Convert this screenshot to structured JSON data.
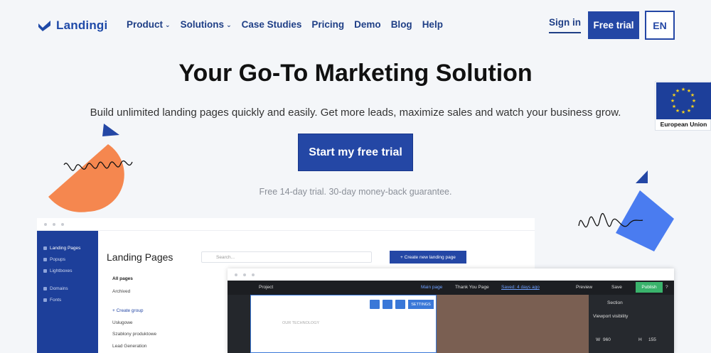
{
  "nav": {
    "logo_text": "Landingi",
    "menu": [
      {
        "label": "Product",
        "has_dropdown": true
      },
      {
        "label": "Solutions",
        "has_dropdown": true
      },
      {
        "label": "Case Studies",
        "has_dropdown": false
      },
      {
        "label": "Pricing",
        "has_dropdown": false
      },
      {
        "label": "Demo",
        "has_dropdown": false
      },
      {
        "label": "Blog",
        "has_dropdown": false
      },
      {
        "label": "Help",
        "has_dropdown": false
      }
    ],
    "chevron": "⌄",
    "sign_in": "Sign in",
    "free_trial": "Free trial",
    "language": "EN"
  },
  "hero": {
    "title": "Your Go-To Marketing Solution",
    "subtitle": "Build unlimited landing pages quickly and easily. Get more leads, maximize sales and watch your business grow.",
    "cta": "Start my free trial",
    "note": "Free 14-day trial. 30-day money-back guarantee."
  },
  "eu_badge": {
    "label": "European Union"
  },
  "app": {
    "sidebar": [
      "Landing Pages",
      "Popups",
      "Lightboxes",
      "Domains",
      "Fonts"
    ],
    "page_title": "Landing Pages",
    "search_placeholder": "Search...",
    "new_button": "+ Create new landing page",
    "filters": [
      "All pages",
      "Archived"
    ],
    "create_group": "+ Create group",
    "groups": [
      "Usługowe",
      "Szablony produktowe",
      "Lead Generation"
    ]
  },
  "editor": {
    "project": "Project",
    "main_page": "Main page",
    "thank_you": "Thank You Page",
    "saved": "Saved: 4 days ago",
    "preview": "Preview",
    "save": "Save",
    "publish": "Publish",
    "help": "?",
    "settings": "SETTINGS",
    "our_technology": "OUR TECHNOLOGY",
    "section": "Section",
    "viewport": "Viewport visibility",
    "w_label": "W",
    "w_value": "960",
    "h_label": "H",
    "h_value": "155"
  },
  "colors": {
    "brand": "#2447a5",
    "orange": "#f5874f",
    "blue_square": "#4a7cf0"
  }
}
